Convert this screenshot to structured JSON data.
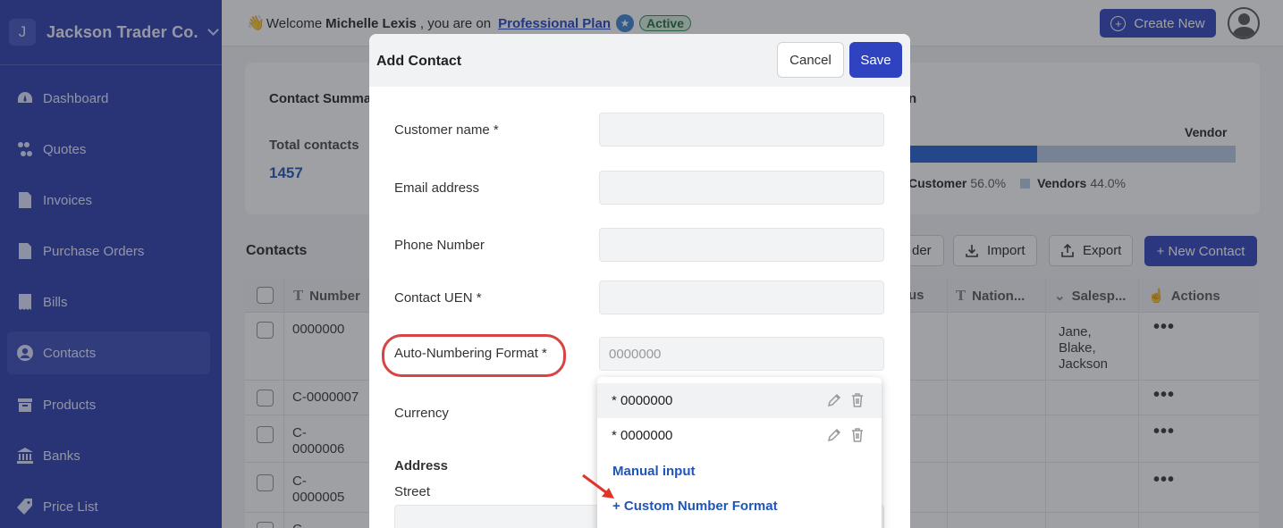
{
  "sidebar": {
    "org_initial": "J",
    "org_name": "Jackson Trader Co.",
    "items": [
      {
        "label": "Dashboard",
        "icon": "gauge-icon"
      },
      {
        "label": "Quotes",
        "icon": "quote-icon"
      },
      {
        "label": "Invoices",
        "icon": "invoice-icon"
      },
      {
        "label": "Purchase Orders",
        "icon": "purchase-order-icon"
      },
      {
        "label": "Bills",
        "icon": "bill-icon"
      },
      {
        "label": "Contacts",
        "icon": "contact-icon",
        "active": true
      },
      {
        "label": "Products",
        "icon": "box-icon"
      },
      {
        "label": "Banks",
        "icon": "bank-icon"
      },
      {
        "label": "Price List",
        "icon": "tag-icon"
      }
    ]
  },
  "topbar": {
    "welcome_prefix": "Welcome",
    "user_name": "Michelle Lexis",
    "welcome_mid": ", you are on",
    "plan": "Professional Plan",
    "status": "Active",
    "create_new": "Create New"
  },
  "summary": {
    "title": "Contact Summa",
    "title_right": "n",
    "total_label": "Total contacts",
    "total_value": "1457",
    "vendor_label": "Vendor",
    "customer_label": "Customer",
    "customer_pct": "56.0%",
    "vendor_legend": "Vendors",
    "vendor_pct": "44.0%",
    "customer_fraction": 0.56
  },
  "contacts": {
    "title": "Contacts",
    "buttons": {
      "header_partial": "der",
      "import": "Import",
      "export": "Export",
      "new_contact": "+ New Contact"
    },
    "columns": {
      "number": "Number",
      "status_partial": "us",
      "nationality": "Nation...",
      "salesperson": "Salesp...",
      "actions": "Actions"
    },
    "rows": [
      {
        "number": "0000000",
        "salesperson": [
          "Jane,",
          "Blake,",
          "Jackson"
        ]
      },
      {
        "number": "C-0000007"
      },
      {
        "number": [
          "C-",
          "0000006"
        ]
      },
      {
        "number": [
          "C-",
          "0000005"
        ]
      },
      {
        "number": "C-"
      }
    ],
    "actions_glyph": "•••"
  },
  "modal": {
    "title": "Add Contact",
    "cancel": "Cancel",
    "save": "Save",
    "fields": {
      "customer_name": "Customer name *",
      "email": "Email address",
      "phone": "Phone Number",
      "uen": "Contact UEN *",
      "auto_numbering": "Auto-Numbering Format *",
      "auto_numbering_placeholder": "0000000",
      "currency": "Currency",
      "address": "Address",
      "street": "Street"
    },
    "dropdown": {
      "options": [
        "* 0000000",
        "* 0000000"
      ],
      "manual_input": "Manual input",
      "custom_format": "+ Custom Number Format"
    }
  },
  "colors": {
    "sidebar": "#2b3bb0",
    "primary": "#2f43c0",
    "link": "#1f55b8",
    "highlight": "#d64545"
  }
}
